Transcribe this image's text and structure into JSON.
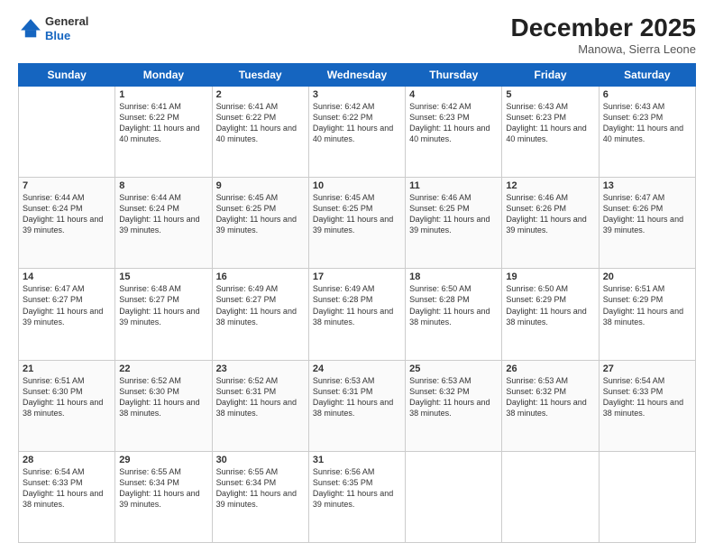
{
  "logo": {
    "general": "General",
    "blue": "Blue"
  },
  "title": {
    "month_year": "December 2025",
    "location": "Manowa, Sierra Leone"
  },
  "days_of_week": [
    "Sunday",
    "Monday",
    "Tuesday",
    "Wednesday",
    "Thursday",
    "Friday",
    "Saturday"
  ],
  "weeks": [
    [
      {
        "day": "",
        "sunrise": "",
        "sunset": "",
        "daylight": ""
      },
      {
        "day": "1",
        "sunrise": "Sunrise: 6:41 AM",
        "sunset": "Sunset: 6:22 PM",
        "daylight": "Daylight: 11 hours and 40 minutes."
      },
      {
        "day": "2",
        "sunrise": "Sunrise: 6:41 AM",
        "sunset": "Sunset: 6:22 PM",
        "daylight": "Daylight: 11 hours and 40 minutes."
      },
      {
        "day": "3",
        "sunrise": "Sunrise: 6:42 AM",
        "sunset": "Sunset: 6:22 PM",
        "daylight": "Daylight: 11 hours and 40 minutes."
      },
      {
        "day": "4",
        "sunrise": "Sunrise: 6:42 AM",
        "sunset": "Sunset: 6:23 PM",
        "daylight": "Daylight: 11 hours and 40 minutes."
      },
      {
        "day": "5",
        "sunrise": "Sunrise: 6:43 AM",
        "sunset": "Sunset: 6:23 PM",
        "daylight": "Daylight: 11 hours and 40 minutes."
      },
      {
        "day": "6",
        "sunrise": "Sunrise: 6:43 AM",
        "sunset": "Sunset: 6:23 PM",
        "daylight": "Daylight: 11 hours and 40 minutes."
      }
    ],
    [
      {
        "day": "7",
        "sunrise": "Sunrise: 6:44 AM",
        "sunset": "Sunset: 6:24 PM",
        "daylight": "Daylight: 11 hours and 39 minutes."
      },
      {
        "day": "8",
        "sunrise": "Sunrise: 6:44 AM",
        "sunset": "Sunset: 6:24 PM",
        "daylight": "Daylight: 11 hours and 39 minutes."
      },
      {
        "day": "9",
        "sunrise": "Sunrise: 6:45 AM",
        "sunset": "Sunset: 6:25 PM",
        "daylight": "Daylight: 11 hours and 39 minutes."
      },
      {
        "day": "10",
        "sunrise": "Sunrise: 6:45 AM",
        "sunset": "Sunset: 6:25 PM",
        "daylight": "Daylight: 11 hours and 39 minutes."
      },
      {
        "day": "11",
        "sunrise": "Sunrise: 6:46 AM",
        "sunset": "Sunset: 6:25 PM",
        "daylight": "Daylight: 11 hours and 39 minutes."
      },
      {
        "day": "12",
        "sunrise": "Sunrise: 6:46 AM",
        "sunset": "Sunset: 6:26 PM",
        "daylight": "Daylight: 11 hours and 39 minutes."
      },
      {
        "day": "13",
        "sunrise": "Sunrise: 6:47 AM",
        "sunset": "Sunset: 6:26 PM",
        "daylight": "Daylight: 11 hours and 39 minutes."
      }
    ],
    [
      {
        "day": "14",
        "sunrise": "Sunrise: 6:47 AM",
        "sunset": "Sunset: 6:27 PM",
        "daylight": "Daylight: 11 hours and 39 minutes."
      },
      {
        "day": "15",
        "sunrise": "Sunrise: 6:48 AM",
        "sunset": "Sunset: 6:27 PM",
        "daylight": "Daylight: 11 hours and 39 minutes."
      },
      {
        "day": "16",
        "sunrise": "Sunrise: 6:49 AM",
        "sunset": "Sunset: 6:27 PM",
        "daylight": "Daylight: 11 hours and 38 minutes."
      },
      {
        "day": "17",
        "sunrise": "Sunrise: 6:49 AM",
        "sunset": "Sunset: 6:28 PM",
        "daylight": "Daylight: 11 hours and 38 minutes."
      },
      {
        "day": "18",
        "sunrise": "Sunrise: 6:50 AM",
        "sunset": "Sunset: 6:28 PM",
        "daylight": "Daylight: 11 hours and 38 minutes."
      },
      {
        "day": "19",
        "sunrise": "Sunrise: 6:50 AM",
        "sunset": "Sunset: 6:29 PM",
        "daylight": "Daylight: 11 hours and 38 minutes."
      },
      {
        "day": "20",
        "sunrise": "Sunrise: 6:51 AM",
        "sunset": "Sunset: 6:29 PM",
        "daylight": "Daylight: 11 hours and 38 minutes."
      }
    ],
    [
      {
        "day": "21",
        "sunrise": "Sunrise: 6:51 AM",
        "sunset": "Sunset: 6:30 PM",
        "daylight": "Daylight: 11 hours and 38 minutes."
      },
      {
        "day": "22",
        "sunrise": "Sunrise: 6:52 AM",
        "sunset": "Sunset: 6:30 PM",
        "daylight": "Daylight: 11 hours and 38 minutes."
      },
      {
        "day": "23",
        "sunrise": "Sunrise: 6:52 AM",
        "sunset": "Sunset: 6:31 PM",
        "daylight": "Daylight: 11 hours and 38 minutes."
      },
      {
        "day": "24",
        "sunrise": "Sunrise: 6:53 AM",
        "sunset": "Sunset: 6:31 PM",
        "daylight": "Daylight: 11 hours and 38 minutes."
      },
      {
        "day": "25",
        "sunrise": "Sunrise: 6:53 AM",
        "sunset": "Sunset: 6:32 PM",
        "daylight": "Daylight: 11 hours and 38 minutes."
      },
      {
        "day": "26",
        "sunrise": "Sunrise: 6:53 AM",
        "sunset": "Sunset: 6:32 PM",
        "daylight": "Daylight: 11 hours and 38 minutes."
      },
      {
        "day": "27",
        "sunrise": "Sunrise: 6:54 AM",
        "sunset": "Sunset: 6:33 PM",
        "daylight": "Daylight: 11 hours and 38 minutes."
      }
    ],
    [
      {
        "day": "28",
        "sunrise": "Sunrise: 6:54 AM",
        "sunset": "Sunset: 6:33 PM",
        "daylight": "Daylight: 11 hours and 38 minutes."
      },
      {
        "day": "29",
        "sunrise": "Sunrise: 6:55 AM",
        "sunset": "Sunset: 6:34 PM",
        "daylight": "Daylight: 11 hours and 39 minutes."
      },
      {
        "day": "30",
        "sunrise": "Sunrise: 6:55 AM",
        "sunset": "Sunset: 6:34 PM",
        "daylight": "Daylight: 11 hours and 39 minutes."
      },
      {
        "day": "31",
        "sunrise": "Sunrise: 6:56 AM",
        "sunset": "Sunset: 6:35 PM",
        "daylight": "Daylight: 11 hours and 39 minutes."
      },
      {
        "day": "",
        "sunrise": "",
        "sunset": "",
        "daylight": ""
      },
      {
        "day": "",
        "sunrise": "",
        "sunset": "",
        "daylight": ""
      },
      {
        "day": "",
        "sunrise": "",
        "sunset": "",
        "daylight": ""
      }
    ]
  ]
}
